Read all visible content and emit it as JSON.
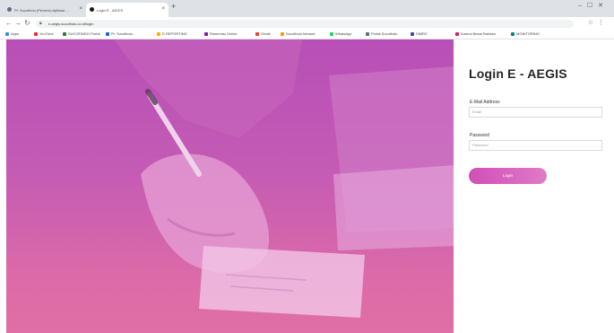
{
  "browser": {
    "tabs": [
      {
        "label": "Pt. Sucofindo (Persero) Aplikasi ...",
        "active": false
      },
      {
        "label": "Login E - AEGIS",
        "active": true
      }
    ],
    "address": "e-aegis.sucofindo.co.id/login",
    "bookmarks": [
      {
        "label": "Apps",
        "color": "#4285f4"
      },
      {
        "label": "YouTube",
        "color": "#e52d27"
      },
      {
        "label": "SUCOFINDO Portal",
        "color": "#2e7d32"
      },
      {
        "label": "Pt. Sucofindo ...",
        "color": "#1565c0"
      },
      {
        "label": "E-REPORTING",
        "color": "#f4b400"
      },
      {
        "label": "Reservasi Online",
        "color": "#7b1fa2"
      },
      {
        "label": "Gmail",
        "color": "#ea4335"
      },
      {
        "label": "Sucofindo Intranet",
        "color": "#ff9800"
      },
      {
        "label": "WhatsApp",
        "color": "#25d366"
      },
      {
        "label": "Portal Sucofindo",
        "color": "#546e7a"
      },
      {
        "label": "SIMRS",
        "color": "#3949ab"
      },
      {
        "label": "Kamus Besar Bahasa",
        "color": "#d81b60"
      },
      {
        "label": "MONITORING",
        "color": "#00897b"
      }
    ]
  },
  "login": {
    "title": "Login E - AEGIS",
    "email_label": "E-Mail Address",
    "email_placeholder": "Email",
    "password_label": "Password",
    "password_placeholder": "Password",
    "submit_label": "Login"
  }
}
